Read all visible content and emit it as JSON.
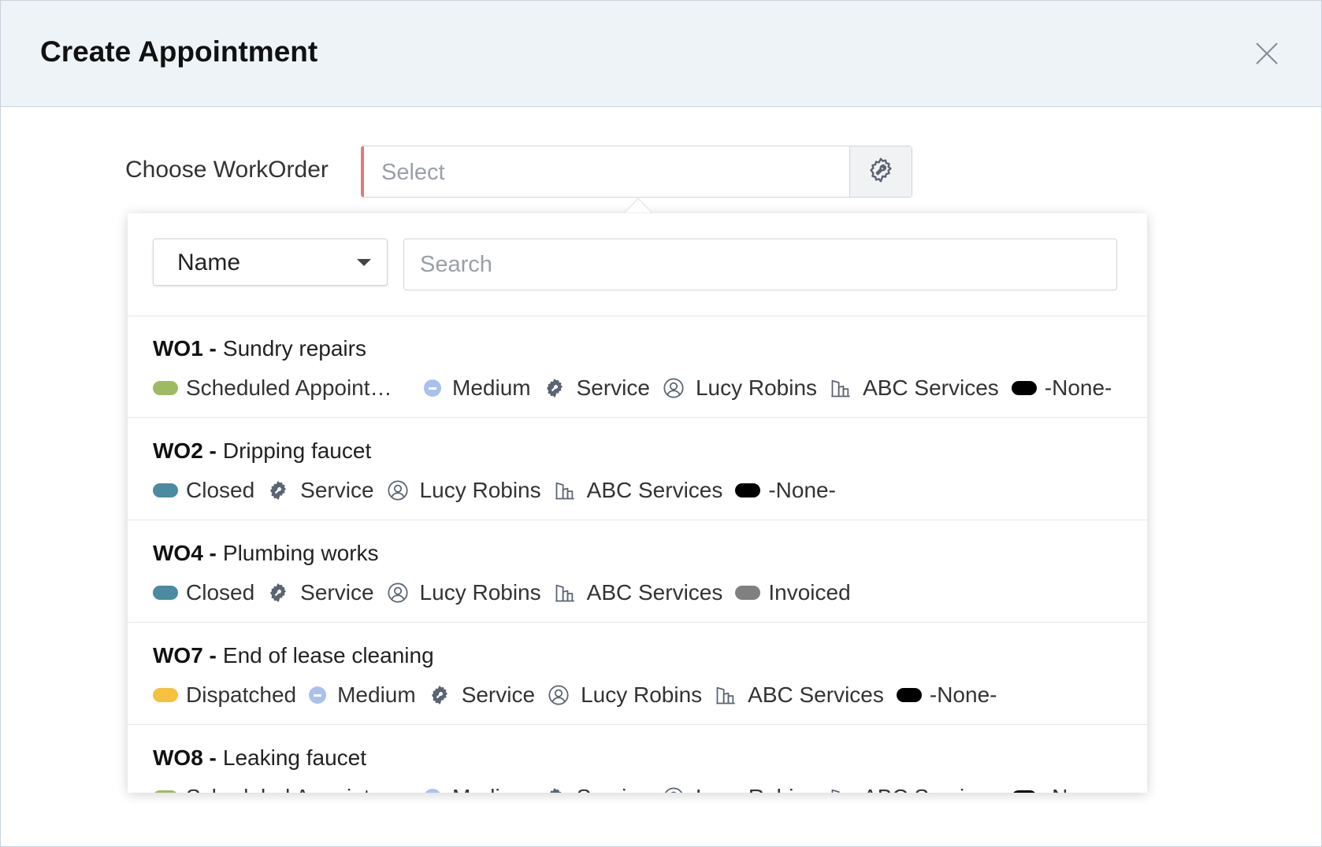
{
  "dialog": {
    "title": "Create Appointment",
    "close_icon": "close-icon"
  },
  "form": {
    "label": "Choose WorkOrder",
    "placeholder": "Select",
    "button_icon": "wrench-gear-icon"
  },
  "dropdown": {
    "filter_field": "Name",
    "search_placeholder": "Search",
    "items": [
      {
        "id": "WO1 -",
        "name": "Sundry repairs",
        "status": {
          "label": "Scheduled Appointm…",
          "color": "#9dbb63"
        },
        "priority": "Medium",
        "type": "Service",
        "contact": "Lucy Robins",
        "company": "ABC Services",
        "billing": {
          "label": "-None-",
          "color": "#000000"
        }
      },
      {
        "id": "WO2 -",
        "name": "Dripping faucet",
        "status": {
          "label": "Closed",
          "color": "#4b8aa0"
        },
        "type": "Service",
        "contact": "Lucy Robins",
        "company": "ABC Services",
        "billing": {
          "label": "-None-",
          "color": "#000000"
        }
      },
      {
        "id": "WO4 -",
        "name": "Plumbing works",
        "status": {
          "label": "Closed",
          "color": "#4b8aa0"
        },
        "type": "Service",
        "contact": "Lucy Robins",
        "company": "ABC Services",
        "billing": {
          "label": "Invoiced",
          "color": "#808080"
        }
      },
      {
        "id": "WO7 -",
        "name": "End of lease cleaning",
        "status": {
          "label": "Dispatched",
          "color": "#f5c13f"
        },
        "priority": "Medium",
        "type": "Service",
        "contact": "Lucy Robins",
        "company": "ABC Services",
        "billing": {
          "label": "-None-",
          "color": "#000000"
        }
      },
      {
        "id": "WO8 -",
        "name": "Leaking faucet",
        "status": {
          "label": "Scheduled Appointm…",
          "color": "#9dbb63"
        },
        "priority": "Medium",
        "type": "Service",
        "contact": "Lucy Robins",
        "company": "ABC Services",
        "billing": {
          "label": "-None-",
          "color": "#000000"
        }
      }
    ]
  },
  "colors": {
    "header_bg": "#eef3f7",
    "required_border": "#e07b7b",
    "priority_medium": "#a9c1ec"
  }
}
